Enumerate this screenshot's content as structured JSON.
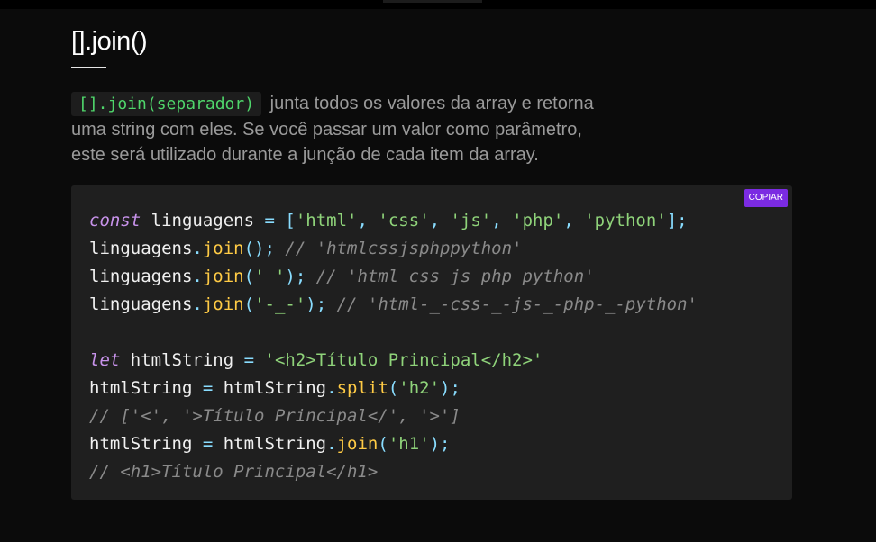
{
  "header": {
    "title": "[].join()"
  },
  "intro": {
    "code": "[].join(separador)",
    "text_line1": "junta todos os valores da array e retorna",
    "text_line2": "uma string com eles. Se você passar um valor como parâmetro,",
    "text_line3": "este será utilizado durante a junção de cada item da array."
  },
  "code_block": {
    "copy_label": "COPIAR",
    "lines": [
      [
        {
          "t": "kw",
          "v": "const"
        },
        {
          "t": "id",
          "v": " linguagens "
        },
        {
          "t": "op",
          "v": "="
        },
        {
          "t": "id",
          "v": " "
        },
        {
          "t": "pun",
          "v": "["
        },
        {
          "t": "str",
          "v": "'html'"
        },
        {
          "t": "pun",
          "v": ", "
        },
        {
          "t": "str",
          "v": "'css'"
        },
        {
          "t": "pun",
          "v": ", "
        },
        {
          "t": "str",
          "v": "'js'"
        },
        {
          "t": "pun",
          "v": ", "
        },
        {
          "t": "str",
          "v": "'php'"
        },
        {
          "t": "pun",
          "v": ", "
        },
        {
          "t": "str",
          "v": "'python'"
        },
        {
          "t": "pun",
          "v": "];"
        }
      ],
      [
        {
          "t": "id",
          "v": "linguagens"
        },
        {
          "t": "pun",
          "v": "."
        },
        {
          "t": "fn",
          "v": "join"
        },
        {
          "t": "pun",
          "v": "(); "
        },
        {
          "t": "cm",
          "v": "// 'htmlcssjsphppython'"
        }
      ],
      [
        {
          "t": "id",
          "v": "linguagens"
        },
        {
          "t": "pun",
          "v": "."
        },
        {
          "t": "fn",
          "v": "join"
        },
        {
          "t": "pun",
          "v": "("
        },
        {
          "t": "str",
          "v": "' '"
        },
        {
          "t": "pun",
          "v": "); "
        },
        {
          "t": "cm",
          "v": "// 'html css js php python'"
        }
      ],
      [
        {
          "t": "id",
          "v": "linguagens"
        },
        {
          "t": "pun",
          "v": "."
        },
        {
          "t": "fn",
          "v": "join"
        },
        {
          "t": "pun",
          "v": "("
        },
        {
          "t": "str",
          "v": "'-_-'"
        },
        {
          "t": "pun",
          "v": "); "
        },
        {
          "t": "cm",
          "v": "// 'html-_-css-_-js-_-php-_-python'"
        }
      ],
      [],
      [
        {
          "t": "kw",
          "v": "let"
        },
        {
          "t": "id",
          "v": " htmlString "
        },
        {
          "t": "op",
          "v": "="
        },
        {
          "t": "id",
          "v": " "
        },
        {
          "t": "str",
          "v": "'<h2>Título Principal</h2>'"
        }
      ],
      [
        {
          "t": "id",
          "v": "htmlString "
        },
        {
          "t": "op",
          "v": "="
        },
        {
          "t": "id",
          "v": " htmlString"
        },
        {
          "t": "pun",
          "v": "."
        },
        {
          "t": "fn",
          "v": "split"
        },
        {
          "t": "pun",
          "v": "("
        },
        {
          "t": "str",
          "v": "'h2'"
        },
        {
          "t": "pun",
          "v": ");"
        }
      ],
      [
        {
          "t": "cm",
          "v": "// ['<', '>Título Principal</', '>']"
        }
      ],
      [
        {
          "t": "id",
          "v": "htmlString "
        },
        {
          "t": "op",
          "v": "="
        },
        {
          "t": "id",
          "v": " htmlString"
        },
        {
          "t": "pun",
          "v": "."
        },
        {
          "t": "fn",
          "v": "join"
        },
        {
          "t": "pun",
          "v": "("
        },
        {
          "t": "str",
          "v": "'h1'"
        },
        {
          "t": "pun",
          "v": ");"
        }
      ],
      [
        {
          "t": "cm",
          "v": "// <h1>Título Principal</h1>"
        }
      ]
    ]
  },
  "colors": {
    "background": "#0b0b0b",
    "code_background": "#1f1f1f",
    "copy_button": "#7b2be2",
    "inline_code": "#4fd66b",
    "keyword": "#c792ea",
    "string": "#8fd37a",
    "function": "#ffcb45",
    "comment": "#8a8a8a"
  }
}
